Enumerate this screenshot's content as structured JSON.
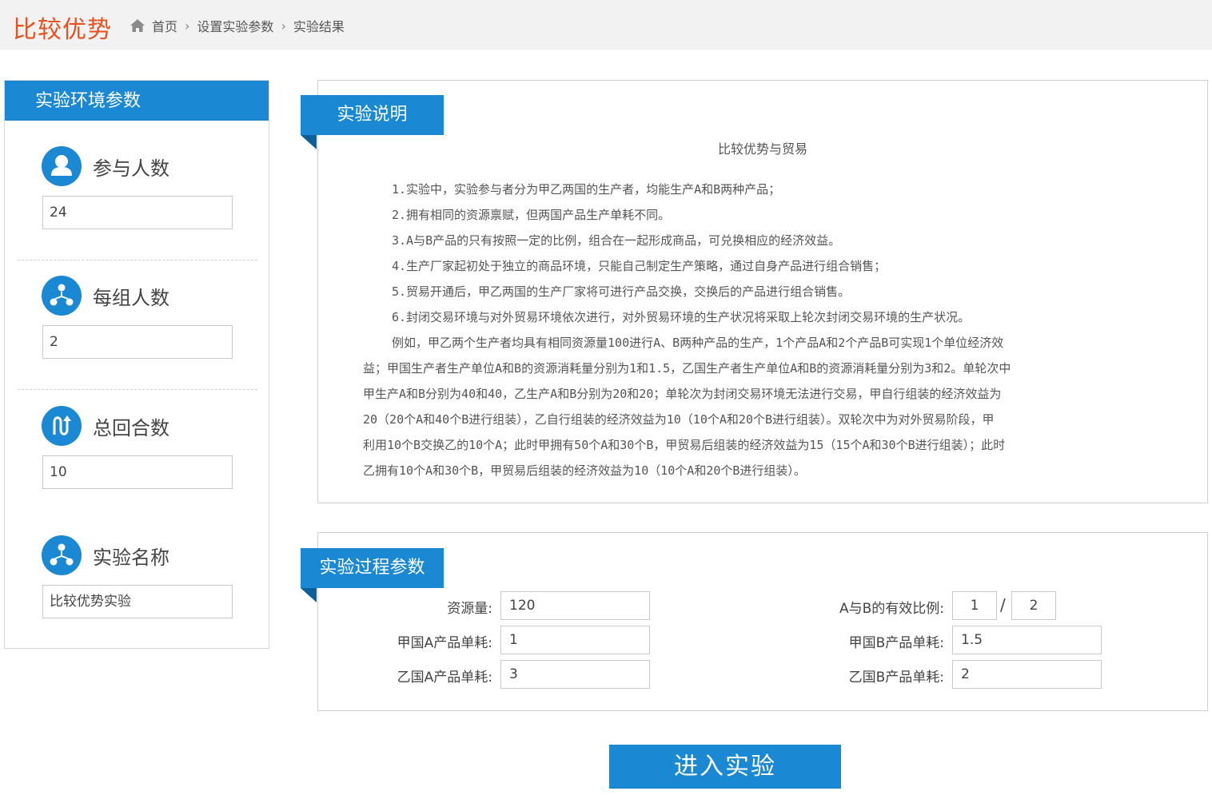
{
  "header": {
    "app_title": "比较优势",
    "breadcrumb": [
      "首页",
      "设置实验参数",
      "实验结果"
    ]
  },
  "env_panel": {
    "title": "实验环境参数",
    "params": [
      {
        "label": "参与人数",
        "value": "24",
        "icon": "user-icon"
      },
      {
        "label": "每组人数",
        "value": "2",
        "icon": "group-icon"
      },
      {
        "label": "总回合数",
        "value": "10",
        "icon": "rounds-icon"
      },
      {
        "label": "实验名称",
        "value": "比较优势实验",
        "icon": "group-icon"
      }
    ]
  },
  "description": {
    "tab": "实验说明",
    "title": "比较优势与贸易",
    "lines": [
      "1.实验中，实验参与者分为甲乙两国的生产者，均能生产A和B两种产品；",
      "2.拥有相同的资源禀赋，但两国产品生产单耗不同。",
      "3.A与B产品的只有按照一定的比例，组合在一起形成商品，可兑换相应的经济效益。",
      "4.生产厂家起初处于独立的商品环境，只能自己制定生产策略，通过自身产品进行组合销售；",
      "5.贸易开通后，甲乙两国的生产厂家将可进行产品交换，交换后的产品进行组合销售。",
      "6.封闭交易环境与对外贸易环境依次进行，对外贸易环境的生产状况将采取上轮次封闭交易环境的生产状况。",
      "例如，甲乙两个生产者均具有相同资源量100进行A、B两种产品的生产，1个产品A和2个产品B可实现1个单位经济效",
      "益；甲国生产者生产单位A和B的资源消耗量分别为1和1.5，乙国生产者生产单位A和B的资源消耗量分别为3和2。单轮次中",
      "甲生产A和B分别为40和40，乙生产A和B分别为20和20；单轮次为封闭交易环境无法进行交易，甲自行组装的经济效益为",
      "20（20个A和40个B进行组装），乙自行组装的经济效益为10（10个A和20个B进行组装）。双轮次中为对外贸易阶段，甲",
      "利用10个B交换乙的10个A；此时甲拥有50个A和30个B，甲贸易后组装的经济效益为15（15个A和30个B进行组装）；此时",
      "乙拥有10个A和30个B，甲贸易后组装的经济效益为10（10个A和20个B进行组装）。"
    ]
  },
  "process": {
    "tab": "实验过程参数",
    "resource_label": "资源量:",
    "resource_value": "120",
    "ratio_label": "A与B的有效比例:",
    "ratio_a": "1",
    "ratio_sep": "/",
    "ratio_b": "2",
    "jia_a_label": "甲国A产品单耗:",
    "jia_a_value": "1",
    "jia_b_label": "甲国B产品单耗:",
    "jia_b_value": "1.5",
    "yi_a_label": "乙国A产品单耗:",
    "yi_a_value": "3",
    "yi_b_label": "乙国B产品单耗:",
    "yi_b_value": "2"
  },
  "enter_button": "进入实验",
  "colors": {
    "accent": "#1a88d2",
    "brand": "#e8501e",
    "tab_fold": "#0d5f99"
  }
}
